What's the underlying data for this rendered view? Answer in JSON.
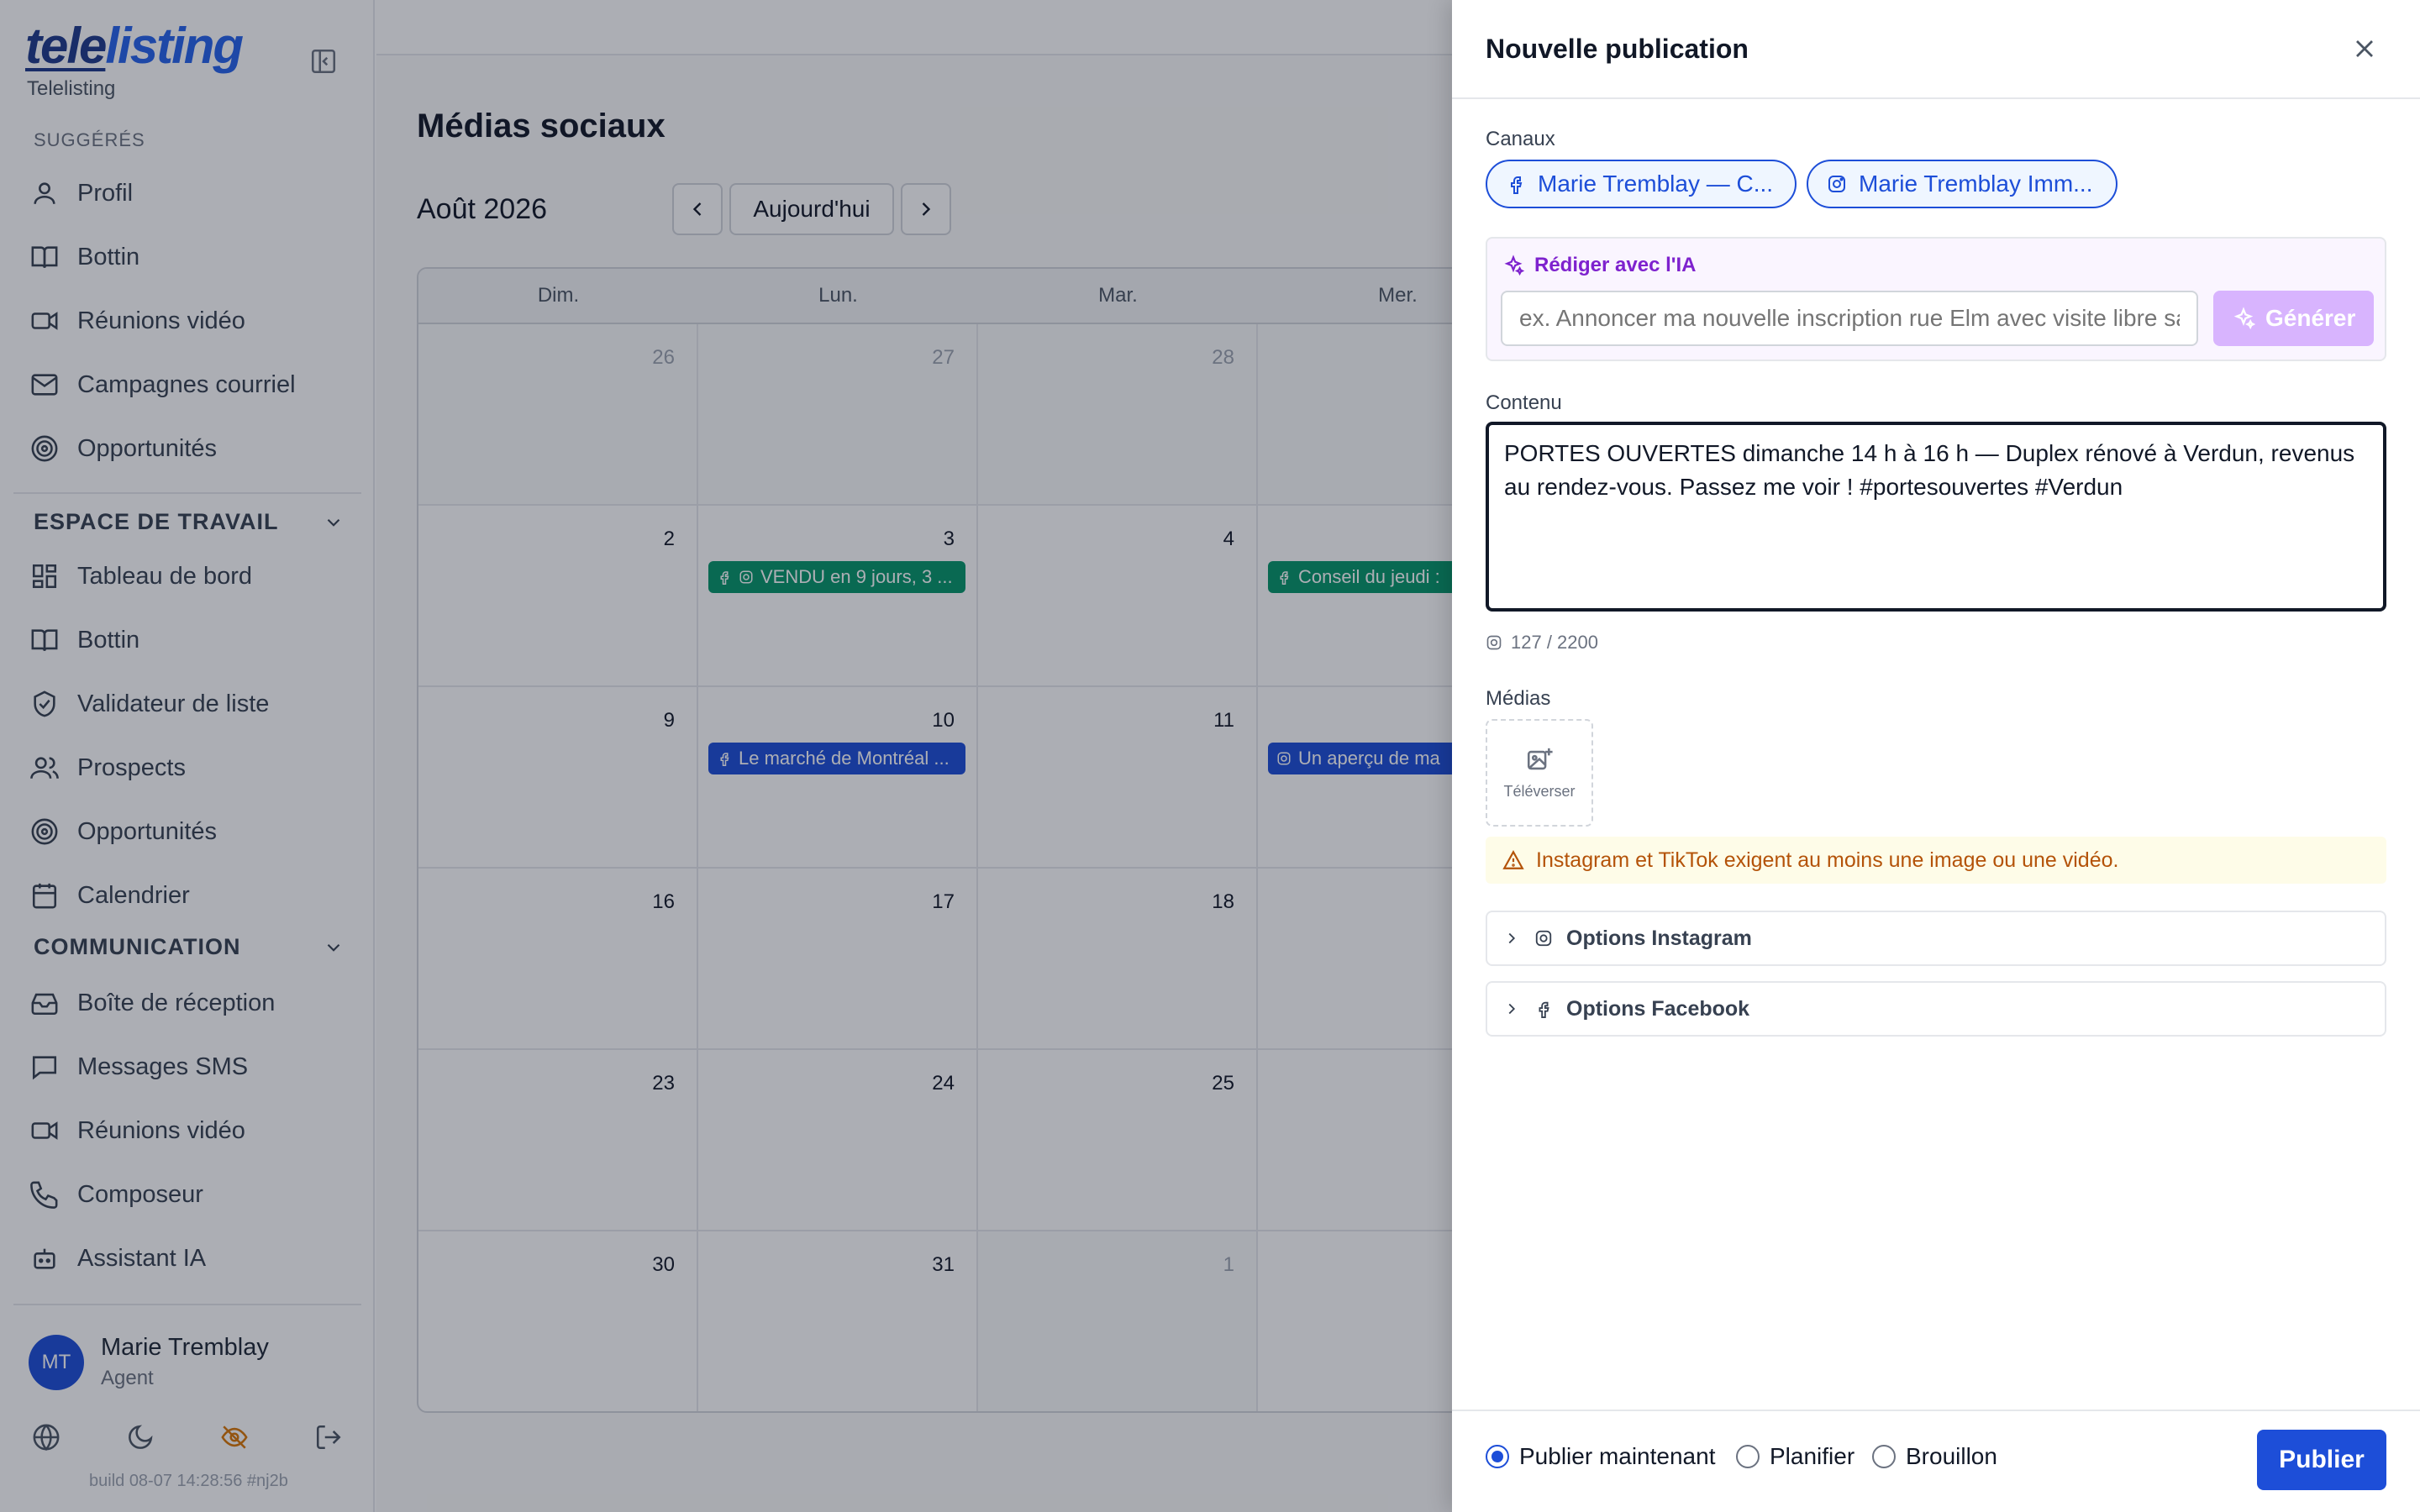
{
  "sidebar": {
    "logo_tele": "tele",
    "logo_listing": "listing",
    "org_name": "Telelisting",
    "suggested_label": "SUGGÉRÉS",
    "suggested": [
      "Profil",
      "Bottin",
      "Réunions vidéo",
      "Campagnes courriel",
      "Opportunités"
    ],
    "workspace_label": "ESPACE DE TRAVAIL",
    "workspace": [
      "Tableau de bord",
      "Bottin",
      "Validateur de liste",
      "Prospects",
      "Opportunités",
      "Calendrier"
    ],
    "communication_label": "COMMUNICATION",
    "communication": [
      "Boîte de réception",
      "Messages SMS",
      "Réunions vidéo",
      "Composeur",
      "Assistant IA"
    ],
    "user": {
      "initials": "MT",
      "name": "Marie Tremblay",
      "role": "Agent"
    },
    "build": "build 08-07 14:28:56 #nj2b"
  },
  "main": {
    "title": "Médias sociaux",
    "month": "Août 2026",
    "today_label": "Aujourd'hui",
    "day_names": [
      "Dim.",
      "Lun.",
      "Mar.",
      "Mer."
    ],
    "weeks": [
      [
        "26",
        "27",
        "28",
        ""
      ],
      [
        "2",
        "3",
        "4",
        ""
      ],
      [
        "9",
        "10",
        "11",
        ""
      ],
      [
        "16",
        "17",
        "18",
        ""
      ],
      [
        "23",
        "24",
        "25",
        ""
      ],
      [
        "30",
        "31",
        "1",
        ""
      ]
    ],
    "events": {
      "mon3": "VENDU en 9 jours, 3 ...",
      "wed5": "Conseil du jeudi :",
      "mon10": "Le marché de Montréal ...",
      "wed12": "Un aperçu de ma"
    }
  },
  "drawer": {
    "title": "Nouvelle publication",
    "channels_label": "Canaux",
    "channels": [
      "Marie Tremblay — C...",
      "Marie Tremblay Imm..."
    ],
    "ai_title": "Rédiger avec l'IA",
    "ai_placeholder": "ex. Annoncer ma nouvelle inscription rue Elm avec visite libre sa",
    "generate_label": "Générer",
    "content_label": "Contenu",
    "content_value": "PORTES OUVERTES dimanche 14 h à 16 h — Duplex rénové à Verdun, revenus au rendez-vous. Passez me voir ! #portesouvertes #Verdun",
    "counter": "127 / 2200",
    "media_label": "Médias",
    "upload_label": "Téléverser",
    "warning": "Instagram et TikTok exigent au moins une image ou une vidéo.",
    "instagram_options": "Options Instagram",
    "facebook_options": "Options Facebook",
    "publish_now": "Publier maintenant",
    "schedule": "Planifier",
    "draft": "Brouillon",
    "publish_button": "Publier"
  },
  "colors": {
    "brand": "#1d4ed8",
    "event_green": "#059669",
    "ai_purple": "#7e22ce",
    "warning": "#b45309"
  }
}
